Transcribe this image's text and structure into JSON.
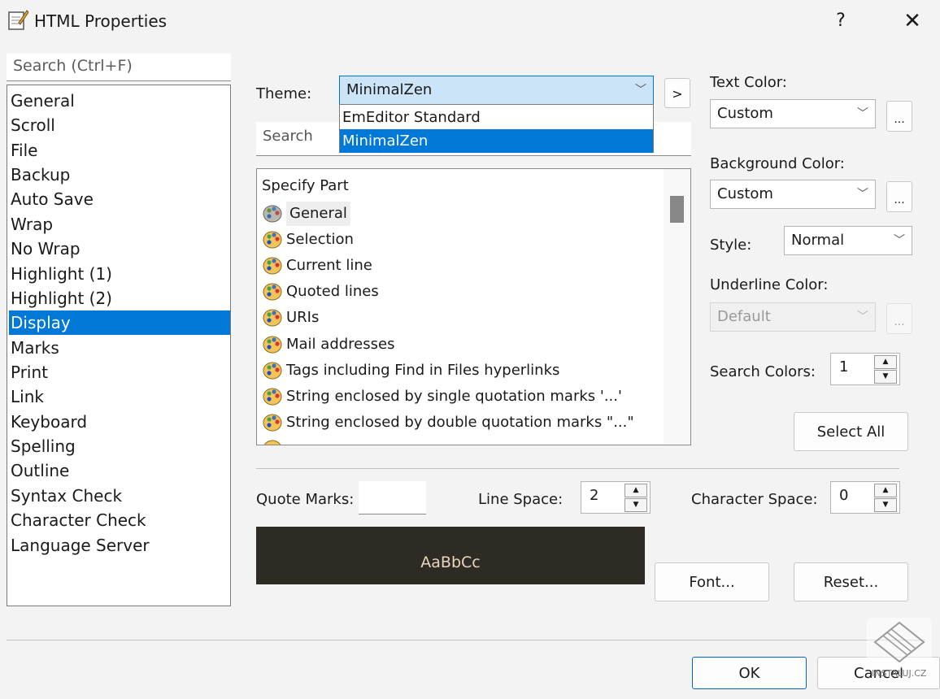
{
  "window": {
    "title": "HTML Properties",
    "help": "?",
    "close": "✕"
  },
  "sidebar": {
    "search_placeholder": "Search (Ctrl+F)",
    "items": [
      "General",
      "Scroll",
      "File",
      "Backup",
      "Auto Save",
      "Wrap",
      "No Wrap",
      "Highlight (1)",
      "Highlight (2)",
      "Display",
      "Marks",
      "Print",
      "Link",
      "Keyboard",
      "Spelling",
      "Outline",
      "Syntax Check",
      "Character Check",
      "Language Server"
    ],
    "selected": "Display"
  },
  "theme": {
    "label": "Theme:",
    "value": "MinimalZen",
    "options": [
      "EmEditor Standard",
      "MinimalZen"
    ],
    "next": ">"
  },
  "search": {
    "placeholder": "Search"
  },
  "parts": {
    "header": "Specify Part",
    "items": [
      "General",
      "Selection",
      "Current line",
      "Quoted lines",
      "URIs",
      "Mail addresses",
      "Tags including Find in Files hyperlinks",
      "String enclosed by single quotation marks '...'",
      "String enclosed by double quotation marks \"...\""
    ]
  },
  "text_color": {
    "label": "Text Color:",
    "value": "Custom",
    "more": "..."
  },
  "background_color": {
    "label": "Background Color:",
    "value": "Custom",
    "more": "..."
  },
  "style": {
    "label": "Style:",
    "value": "Normal"
  },
  "underline_color": {
    "label": "Underline Color:",
    "value": "Default",
    "more": "..."
  },
  "search_colors": {
    "label": "Search Colors:",
    "value": "1"
  },
  "select_all": "Select All",
  "quote_marks": {
    "label": "Quote Marks:",
    "value": ""
  },
  "line_space": {
    "label": "Line Space:",
    "value": "2"
  },
  "char_space": {
    "label": "Character Space:",
    "value": "0"
  },
  "preview": {
    "text": "AaBbCc",
    "bg": "#2e2a24",
    "fg": "#e6d8bc"
  },
  "font_button": "Font...",
  "reset_button": "Reset...",
  "ok_button": "OK",
  "cancel_button": "Cancel",
  "watermark": "INSTALUJ.CZ",
  "colors": {
    "accent": "#0078d7"
  }
}
